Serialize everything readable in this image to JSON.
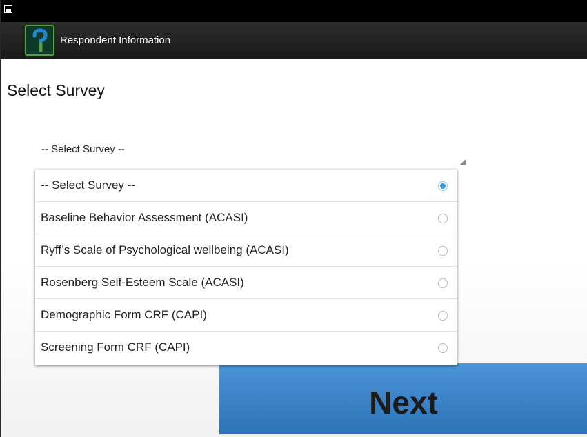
{
  "status_bar": {
    "icon": "image-icon"
  },
  "app_bar": {
    "title": "Respondent Information",
    "logo_icon": "app-logo-icon",
    "logo_colors": {
      "frame": "#5aa33a",
      "blue": "#1e88d6",
      "green": "#4fa33a"
    }
  },
  "page": {
    "title": "Select Survey"
  },
  "survey_spinner": {
    "selected_value": "-- Select Survey --"
  },
  "dropdown": {
    "options": [
      {
        "label": "-- Select Survey --",
        "selected": true
      },
      {
        "label": "Baseline Behavior Assessment (ACASI)",
        "selected": false
      },
      {
        "label": "Ryff’s Scale of Psychological wellbeing (ACASI)",
        "selected": false
      },
      {
        "label": "Rosenberg Self-Esteem Scale (ACASI)",
        "selected": false
      },
      {
        "label": "Demographic Form CRF (CAPI)",
        "selected": false
      },
      {
        "label": "Screening Form CRF (CAPI)",
        "selected": false
      }
    ]
  },
  "next_button": {
    "label": "Next",
    "color": "#3a86cc"
  },
  "colors": {
    "accent": "#2b9ee8",
    "action_bar": "#222222"
  }
}
